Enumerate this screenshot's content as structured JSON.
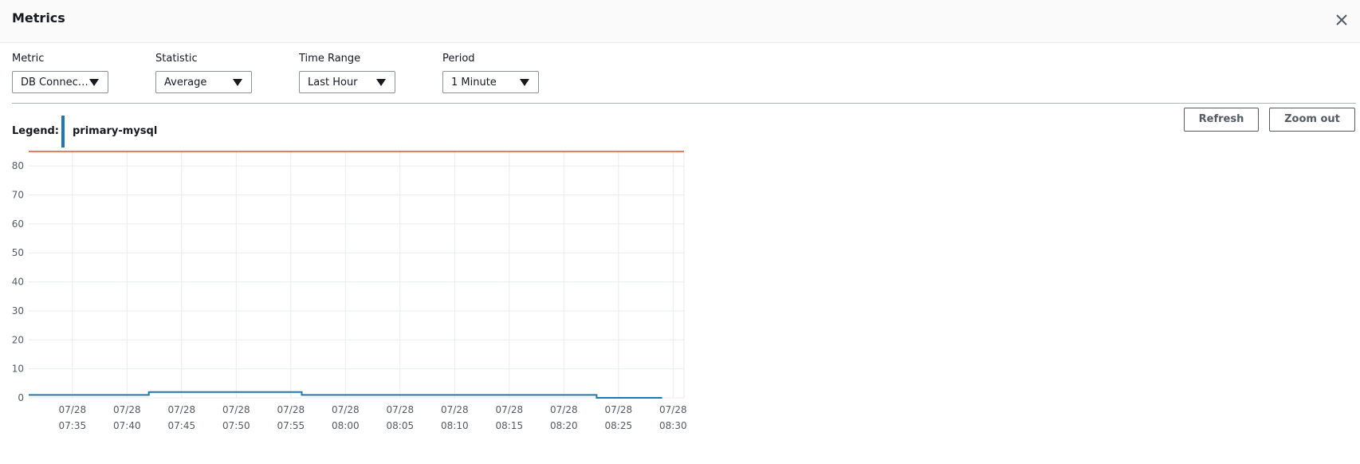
{
  "header": {
    "title": "Metrics"
  },
  "controls": {
    "metric": {
      "label": "Metric",
      "value": "DB Connec…"
    },
    "statistic": {
      "label": "Statistic",
      "value": "Average"
    },
    "time_range": {
      "label": "Time Range",
      "value": "Last Hour"
    },
    "period": {
      "label": "Period",
      "value": "1 Minute"
    }
  },
  "actions": {
    "refresh": "Refresh",
    "zoom_out": "Zoom out"
  },
  "legend": {
    "label": "Legend:",
    "series_name": "primary-mysql",
    "series_color": "#1f77b4"
  },
  "colors": {
    "threshold": "#d13212",
    "series": "#1f77b4",
    "grid": "#eaeded"
  },
  "chart_data": {
    "type": "line",
    "xlabel": "",
    "ylabel": "",
    "yticks": [
      0,
      10,
      20,
      30,
      40,
      50,
      60,
      70,
      80
    ],
    "ylim": [
      0,
      85
    ],
    "xticks": [
      {
        "date": "07/28",
        "time": "07:35"
      },
      {
        "date": "07/28",
        "time": "07:40"
      },
      {
        "date": "07/28",
        "time": "07:45"
      },
      {
        "date": "07/28",
        "time": "07:50"
      },
      {
        "date": "07/28",
        "time": "07:55"
      },
      {
        "date": "07/28",
        "time": "08:00"
      },
      {
        "date": "07/28",
        "time": "08:05"
      },
      {
        "date": "07/28",
        "time": "08:10"
      },
      {
        "date": "07/28",
        "time": "08:15"
      },
      {
        "date": "07/28",
        "time": "08:20"
      },
      {
        "date": "07/28",
        "time": "08:25"
      },
      {
        "date": "07/28",
        "time": "08:30"
      }
    ],
    "xlim": [
      "07:31",
      "08:31"
    ],
    "threshold": 85,
    "grid": true,
    "series": [
      {
        "name": "primary-mysql",
        "step": true,
        "points": [
          {
            "x": "07:31",
            "y": 1
          },
          {
            "x": "07:42",
            "y": 2
          },
          {
            "x": "07:56",
            "y": 1
          },
          {
            "x": "08:23",
            "y": 0
          },
          {
            "x": "08:29",
            "y": 0
          }
        ]
      }
    ]
  }
}
